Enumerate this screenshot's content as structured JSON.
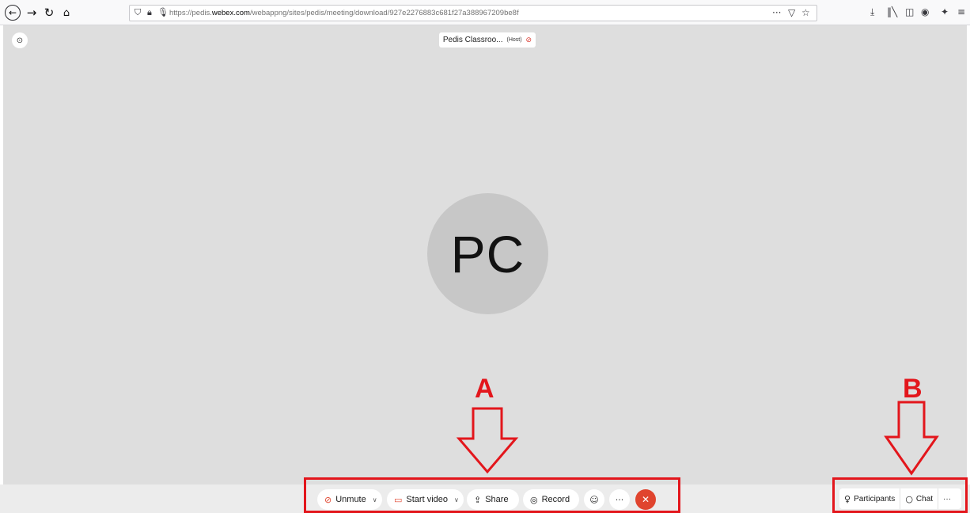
{
  "browser": {
    "back_icon": "arrow-left",
    "forward_icon": "arrow-right",
    "reload_icon": "reload",
    "home_icon": "home",
    "url_prefix": "https://pedis.",
    "url_domain": "webex.com",
    "url_rest": "/webappng/sites/pedis/meeting/download/927e2276883c681f27a388967209be8f",
    "page_actions_label": "···"
  },
  "meeting": {
    "host_name": "Pedis Classroo...",
    "host_role": "(Host)",
    "avatar_initials": "PC"
  },
  "controls": {
    "unmute_label": "Unmute",
    "start_video_label": "Start video",
    "share_label": "Share",
    "record_label": "Record",
    "more_label": "···"
  },
  "panel_controls": {
    "participants_label": "Participants",
    "chat_label": "Chat",
    "more_label": "···"
  },
  "annotations": {
    "label_a": "A",
    "label_b": "B",
    "color": "#e3161c"
  }
}
